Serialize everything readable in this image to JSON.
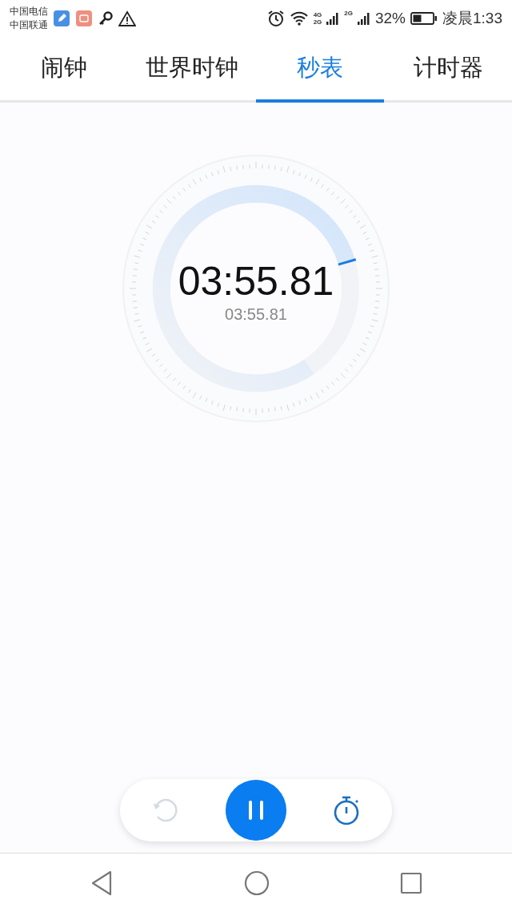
{
  "status_bar": {
    "carriers": [
      "中国电信",
      "中国联通"
    ],
    "sim1_network": [
      "4G",
      "2G"
    ],
    "sim2_network": "2G",
    "battery": "32%",
    "time": "凌晨1:33"
  },
  "tabs": [
    {
      "label": "闹钟",
      "selected": false
    },
    {
      "label": "世界时钟",
      "selected": false
    },
    {
      "label": "秒表",
      "selected": true
    },
    {
      "label": "计时器",
      "selected": false
    }
  ],
  "stopwatch": {
    "time": "03:55.81",
    "lap_time": "03:55.81"
  },
  "controls": [
    {
      "kind": "reset",
      "disabled": true
    },
    {
      "kind": "pause",
      "disabled": false
    },
    {
      "kind": "lap",
      "disabled": false
    }
  ],
  "nav_bar": [
    {
      "kind": "back"
    },
    {
      "kind": "home"
    },
    {
      "kind": "recents"
    }
  ]
}
